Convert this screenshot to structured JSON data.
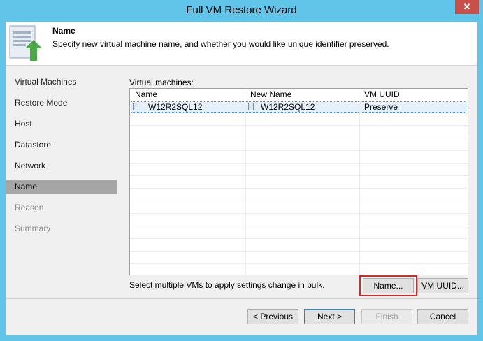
{
  "window": {
    "title": "Full VM Restore Wizard",
    "close_glyph": "✕"
  },
  "header": {
    "title": "Name",
    "description": "Specify new virtual machine name, and whether you would like unique identifier preserved.",
    "icon": "wizard-restore-icon"
  },
  "nav": {
    "items": [
      {
        "label": "Virtual Machines",
        "state": "normal"
      },
      {
        "label": "Restore Mode",
        "state": "normal"
      },
      {
        "label": "Host",
        "state": "normal"
      },
      {
        "label": "Datastore",
        "state": "normal"
      },
      {
        "label": "Network",
        "state": "normal"
      },
      {
        "label": "Name",
        "state": "active"
      },
      {
        "label": "Reason",
        "state": "disabled"
      },
      {
        "label": "Summary",
        "state": "disabled"
      }
    ]
  },
  "main": {
    "vm_label": "Virtual machines:",
    "columns": [
      "Name",
      "New Name",
      "VM UUID"
    ],
    "rows": [
      {
        "name": "W12R2SQL12",
        "new_name": "W12R2SQL12",
        "uuid": "Preserve"
      }
    ],
    "bulk_hint": "Select multiple VMs to apply settings change in bulk.",
    "name_button": "Name...",
    "uuid_button": "VM UUID..."
  },
  "footer": {
    "previous": "< Previous",
    "next": "Next >",
    "finish": "Finish",
    "cancel": "Cancel"
  },
  "colors": {
    "title_bar": "#61c4e9",
    "close_button": "#c7504a",
    "selected_nav": "#a6a6a6",
    "highlight": "#d22b2b"
  }
}
